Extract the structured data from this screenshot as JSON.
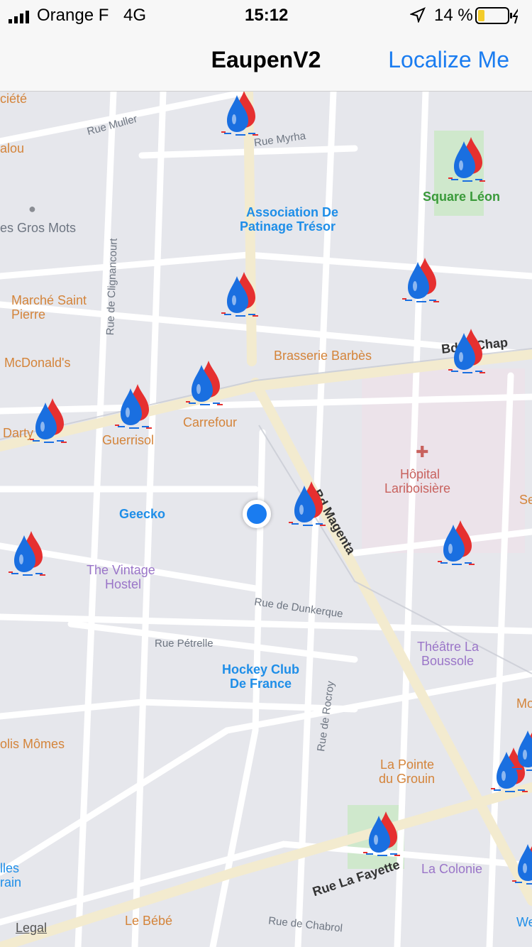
{
  "status": {
    "carrier": "Orange F",
    "network": "4G",
    "time": "15:12",
    "battery": "14 %"
  },
  "nav": {
    "title": "EaupenV2",
    "localize_label": "Localize Me"
  },
  "map": {
    "legal": "Legal",
    "streets": [
      "Rue Muller",
      "Rue Myrha",
      "Rue de Clignancourt",
      "Rue de Dunkerque",
      "Rue Pétrelle",
      "Rue de Rocroy",
      "Rue La Fayette",
      "Rue de Chabrol",
      "Bd la Chap",
      "Bd Magenta"
    ],
    "places": {
      "societe": "ciété",
      "alou": "alou",
      "gros_mots": "es Gros Mots",
      "association": "Association De",
      "association2": "Patinage Trésor",
      "square": "Square Léon",
      "marche": "Marché Saint",
      "marche2": "Pierre",
      "mcdonalds": "McDonald's",
      "brasserie": "Brasserie Barbès",
      "carrefour": "Carrefour",
      "darty": "Darty",
      "guerrisol": "Guerrisol",
      "hopital": "Hôpital",
      "hopital2": "Lariboisière",
      "se": "Se",
      "geecko": "Geecko",
      "vintage": "The Vintage",
      "vintage2": "Hostel",
      "hockey": "Hockey Club",
      "hockey2": "De France",
      "theatre": "Théâtre La",
      "theatre2": "Boussole",
      "mo": "Mo",
      "polis": "olis Mômes",
      "pointe": "La Pointe",
      "pointe2": "du Grouin",
      "colonie": "La Colonie",
      "lles": "lles",
      "rain": "rain",
      "bebe": "Le Bébé",
      "we": "We"
    }
  },
  "colors": {
    "accent": "#1a7cf0",
    "drop_blue": "#1a6fe0",
    "drop_red": "#e63030"
  }
}
